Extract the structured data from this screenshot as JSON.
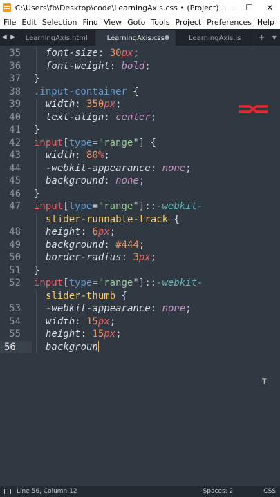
{
  "window": {
    "title": "C:\\Users\\fb\\Desktop\\code\\LearningAxis.css • (Project) - Subl...",
    "minimize": "—",
    "maximize": "☐",
    "close": "✕"
  },
  "menu": [
    "File",
    "Edit",
    "Selection",
    "Find",
    "View",
    "Goto",
    "Tools",
    "Project",
    "Preferences",
    "Help"
  ],
  "tabs": {
    "nav_prev": "◀",
    "nav_next": "▶",
    "items": [
      {
        "label": "LearningAxis.html"
      },
      {
        "label": "LearningAxis.css"
      },
      {
        "label": "LearningAxis.js"
      }
    ],
    "add_label": "+",
    "dropdown_label": "▾"
  },
  "editor": {
    "line_numbers": [
      "35",
      "36",
      "37",
      "38",
      "39",
      "40",
      "41",
      "42",
      "43",
      "44",
      "45",
      "46",
      "47",
      "",
      "48",
      "49",
      "50",
      "51",
      "52",
      "",
      "53",
      "54",
      "55",
      "56"
    ],
    "lines": [
      [
        {
          "t": "font-size",
          "c": "t-prop"
        },
        {
          "t": ": ",
          "c": "t-punc"
        },
        {
          "t": "30",
          "c": "t-num"
        },
        {
          "t": "px",
          "c": "t-unit"
        },
        {
          "t": ";",
          "c": "t-punc"
        }
      ],
      [
        {
          "t": "font-weight",
          "c": "t-prop"
        },
        {
          "t": ": ",
          "c": "t-punc"
        },
        {
          "t": "bold",
          "c": "t-kw"
        },
        {
          "t": ";",
          "c": "t-punc"
        }
      ],
      [
        {
          "t": "}",
          "c": "t-punc"
        }
      ],
      [
        {
          "t": ".input-container",
          "c": "t-class"
        },
        {
          "t": " {",
          "c": "t-punc"
        }
      ],
      [
        {
          "t": "width",
          "c": "t-prop"
        },
        {
          "t": ": ",
          "c": "t-punc"
        },
        {
          "t": "350",
          "c": "t-num"
        },
        {
          "t": "px",
          "c": "t-unit"
        },
        {
          "t": ";",
          "c": "t-punc"
        }
      ],
      [
        {
          "t": "text-align",
          "c": "t-prop"
        },
        {
          "t": ": ",
          "c": "t-punc"
        },
        {
          "t": "center",
          "c": "t-kw"
        },
        {
          "t": ";",
          "c": "t-punc"
        }
      ],
      [
        {
          "t": "}",
          "c": "t-punc"
        }
      ],
      [
        {
          "t": "input",
          "c": "t-tag"
        },
        {
          "t": "[",
          "c": "t-punc"
        },
        {
          "t": "type",
          "c": "t-class"
        },
        {
          "t": "=",
          "c": "t-punc"
        },
        {
          "t": "\"range\"",
          "c": "t-str"
        },
        {
          "t": "] {",
          "c": "t-punc"
        }
      ],
      [
        {
          "t": "width",
          "c": "t-prop"
        },
        {
          "t": ": ",
          "c": "t-punc"
        },
        {
          "t": "80",
          "c": "t-num"
        },
        {
          "t": "%",
          "c": "t-unit"
        },
        {
          "t": ";",
          "c": "t-punc"
        }
      ],
      [
        {
          "t": "-webkit-appearance",
          "c": "t-prop"
        },
        {
          "t": ": ",
          "c": "t-punc"
        },
        {
          "t": "none",
          "c": "t-kw"
        },
        {
          "t": ";",
          "c": "t-punc"
        }
      ],
      [
        {
          "t": "background",
          "c": "t-prop"
        },
        {
          "t": ": ",
          "c": "t-punc"
        },
        {
          "t": "none",
          "c": "t-kw"
        },
        {
          "t": ";",
          "c": "t-punc"
        }
      ],
      [
        {
          "t": "}",
          "c": "t-punc"
        }
      ],
      [
        {
          "t": "input",
          "c": "t-tag"
        },
        {
          "t": "[",
          "c": "t-punc"
        },
        {
          "t": "type",
          "c": "t-class"
        },
        {
          "t": "=",
          "c": "t-punc"
        },
        {
          "t": "\"range\"",
          "c": "t-str"
        },
        {
          "t": "]::",
          "c": "t-punc"
        },
        {
          "t": "-webkit-",
          "c": "t-pseudo"
        }
      ],
      [
        {
          "t": "slider-runnable-track",
          "c": "t-sel"
        },
        {
          "t": " {",
          "c": "t-punc"
        }
      ],
      [
        {
          "t": "height",
          "c": "t-prop"
        },
        {
          "t": ": ",
          "c": "t-punc"
        },
        {
          "t": "6",
          "c": "t-num"
        },
        {
          "t": "px",
          "c": "t-unit"
        },
        {
          "t": ";",
          "c": "t-punc"
        }
      ],
      [
        {
          "t": "background",
          "c": "t-prop"
        },
        {
          "t": ": ",
          "c": "t-punc"
        },
        {
          "t": "#444",
          "c": "t-num"
        },
        {
          "t": ";",
          "c": "t-punc"
        }
      ],
      [
        {
          "t": "border-radius",
          "c": "t-prop"
        },
        {
          "t": ": ",
          "c": "t-punc"
        },
        {
          "t": "3",
          "c": "t-num"
        },
        {
          "t": "px",
          "c": "t-unit"
        },
        {
          "t": ";",
          "c": "t-punc"
        }
      ],
      [
        {
          "t": "}",
          "c": "t-punc"
        }
      ],
      [
        {
          "t": "input",
          "c": "t-tag"
        },
        {
          "t": "[",
          "c": "t-punc"
        },
        {
          "t": "type",
          "c": "t-class"
        },
        {
          "t": "=",
          "c": "t-punc"
        },
        {
          "t": "\"range\"",
          "c": "t-str"
        },
        {
          "t": "]::",
          "c": "t-punc"
        },
        {
          "t": "-webkit-",
          "c": "t-pseudo"
        }
      ],
      [
        {
          "t": "slider-thumb",
          "c": "t-sel"
        },
        {
          "t": " {",
          "c": "t-punc"
        }
      ],
      [
        {
          "t": "-webkit-appearance",
          "c": "t-prop"
        },
        {
          "t": ": ",
          "c": "t-punc"
        },
        {
          "t": "none",
          "c": "t-kw"
        },
        {
          "t": ";",
          "c": "t-punc"
        }
      ],
      [
        {
          "t": "width",
          "c": "t-prop"
        },
        {
          "t": ": ",
          "c": "t-punc"
        },
        {
          "t": "15",
          "c": "t-num"
        },
        {
          "t": "px",
          "c": "t-unit"
        },
        {
          "t": ";",
          "c": "t-punc"
        }
      ],
      [
        {
          "t": "height",
          "c": "t-prop"
        },
        {
          "t": ": ",
          "c": "t-punc"
        },
        {
          "t": "15",
          "c": "t-num"
        },
        {
          "t": "px",
          "c": "t-unit"
        },
        {
          "t": ";",
          "c": "t-punc"
        }
      ],
      [
        {
          "t": "backgroun",
          "c": "t-prop"
        }
      ]
    ],
    "current_line": "56",
    "brand_logo_icon": "red-swoosh-logo-icon",
    "mouse_cursor_icon": "text-ibeam-cursor-icon"
  },
  "status": {
    "position": "Line 56, Column 12",
    "spaces": "Spaces: 2",
    "syntax": "CSS"
  },
  "colors": {
    "background": "#303841",
    "selector": "#fac863",
    "number": "#f99157",
    "unit": "#ec5f67",
    "keyword": "#c594c5",
    "string": "#99c794",
    "tag": "#ec5f67",
    "pseudo": "#5fb3b3",
    "class": "#6699cc",
    "cursor": "#f9ae58",
    "logo": "#e8262b"
  }
}
